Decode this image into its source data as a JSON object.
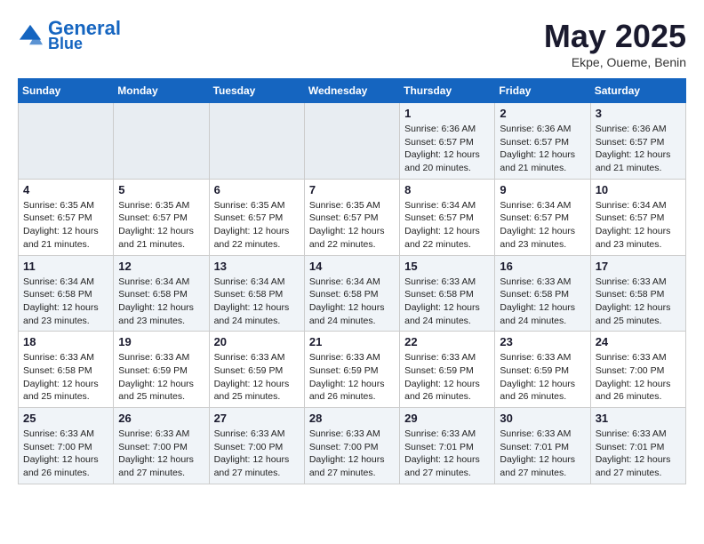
{
  "header": {
    "logo_line1": "General",
    "logo_line2": "Blue",
    "title": "May 2025",
    "subtitle": "Ekpe, Oueme, Benin"
  },
  "days_of_week": [
    "Sunday",
    "Monday",
    "Tuesday",
    "Wednesday",
    "Thursday",
    "Friday",
    "Saturday"
  ],
  "weeks": [
    [
      {
        "num": "",
        "info": ""
      },
      {
        "num": "",
        "info": ""
      },
      {
        "num": "",
        "info": ""
      },
      {
        "num": "",
        "info": ""
      },
      {
        "num": "1",
        "info": "Sunrise: 6:36 AM\nSunset: 6:57 PM\nDaylight: 12 hours and 20 minutes."
      },
      {
        "num": "2",
        "info": "Sunrise: 6:36 AM\nSunset: 6:57 PM\nDaylight: 12 hours and 21 minutes."
      },
      {
        "num": "3",
        "info": "Sunrise: 6:36 AM\nSunset: 6:57 PM\nDaylight: 12 hours and 21 minutes."
      }
    ],
    [
      {
        "num": "4",
        "info": "Sunrise: 6:35 AM\nSunset: 6:57 PM\nDaylight: 12 hours and 21 minutes."
      },
      {
        "num": "5",
        "info": "Sunrise: 6:35 AM\nSunset: 6:57 PM\nDaylight: 12 hours and 21 minutes."
      },
      {
        "num": "6",
        "info": "Sunrise: 6:35 AM\nSunset: 6:57 PM\nDaylight: 12 hours and 22 minutes."
      },
      {
        "num": "7",
        "info": "Sunrise: 6:35 AM\nSunset: 6:57 PM\nDaylight: 12 hours and 22 minutes."
      },
      {
        "num": "8",
        "info": "Sunrise: 6:34 AM\nSunset: 6:57 PM\nDaylight: 12 hours and 22 minutes."
      },
      {
        "num": "9",
        "info": "Sunrise: 6:34 AM\nSunset: 6:57 PM\nDaylight: 12 hours and 23 minutes."
      },
      {
        "num": "10",
        "info": "Sunrise: 6:34 AM\nSunset: 6:57 PM\nDaylight: 12 hours and 23 minutes."
      }
    ],
    [
      {
        "num": "11",
        "info": "Sunrise: 6:34 AM\nSunset: 6:58 PM\nDaylight: 12 hours and 23 minutes."
      },
      {
        "num": "12",
        "info": "Sunrise: 6:34 AM\nSunset: 6:58 PM\nDaylight: 12 hours and 23 minutes."
      },
      {
        "num": "13",
        "info": "Sunrise: 6:34 AM\nSunset: 6:58 PM\nDaylight: 12 hours and 24 minutes."
      },
      {
        "num": "14",
        "info": "Sunrise: 6:34 AM\nSunset: 6:58 PM\nDaylight: 12 hours and 24 minutes."
      },
      {
        "num": "15",
        "info": "Sunrise: 6:33 AM\nSunset: 6:58 PM\nDaylight: 12 hours and 24 minutes."
      },
      {
        "num": "16",
        "info": "Sunrise: 6:33 AM\nSunset: 6:58 PM\nDaylight: 12 hours and 24 minutes."
      },
      {
        "num": "17",
        "info": "Sunrise: 6:33 AM\nSunset: 6:58 PM\nDaylight: 12 hours and 25 minutes."
      }
    ],
    [
      {
        "num": "18",
        "info": "Sunrise: 6:33 AM\nSunset: 6:58 PM\nDaylight: 12 hours and 25 minutes."
      },
      {
        "num": "19",
        "info": "Sunrise: 6:33 AM\nSunset: 6:59 PM\nDaylight: 12 hours and 25 minutes."
      },
      {
        "num": "20",
        "info": "Sunrise: 6:33 AM\nSunset: 6:59 PM\nDaylight: 12 hours and 25 minutes."
      },
      {
        "num": "21",
        "info": "Sunrise: 6:33 AM\nSunset: 6:59 PM\nDaylight: 12 hours and 26 minutes."
      },
      {
        "num": "22",
        "info": "Sunrise: 6:33 AM\nSunset: 6:59 PM\nDaylight: 12 hours and 26 minutes."
      },
      {
        "num": "23",
        "info": "Sunrise: 6:33 AM\nSunset: 6:59 PM\nDaylight: 12 hours and 26 minutes."
      },
      {
        "num": "24",
        "info": "Sunrise: 6:33 AM\nSunset: 7:00 PM\nDaylight: 12 hours and 26 minutes."
      }
    ],
    [
      {
        "num": "25",
        "info": "Sunrise: 6:33 AM\nSunset: 7:00 PM\nDaylight: 12 hours and 26 minutes."
      },
      {
        "num": "26",
        "info": "Sunrise: 6:33 AM\nSunset: 7:00 PM\nDaylight: 12 hours and 27 minutes."
      },
      {
        "num": "27",
        "info": "Sunrise: 6:33 AM\nSunset: 7:00 PM\nDaylight: 12 hours and 27 minutes."
      },
      {
        "num": "28",
        "info": "Sunrise: 6:33 AM\nSunset: 7:00 PM\nDaylight: 12 hours and 27 minutes."
      },
      {
        "num": "29",
        "info": "Sunrise: 6:33 AM\nSunset: 7:01 PM\nDaylight: 12 hours and 27 minutes."
      },
      {
        "num": "30",
        "info": "Sunrise: 6:33 AM\nSunset: 7:01 PM\nDaylight: 12 hours and 27 minutes."
      },
      {
        "num": "31",
        "info": "Sunrise: 6:33 AM\nSunset: 7:01 PM\nDaylight: 12 hours and 27 minutes."
      }
    ]
  ]
}
